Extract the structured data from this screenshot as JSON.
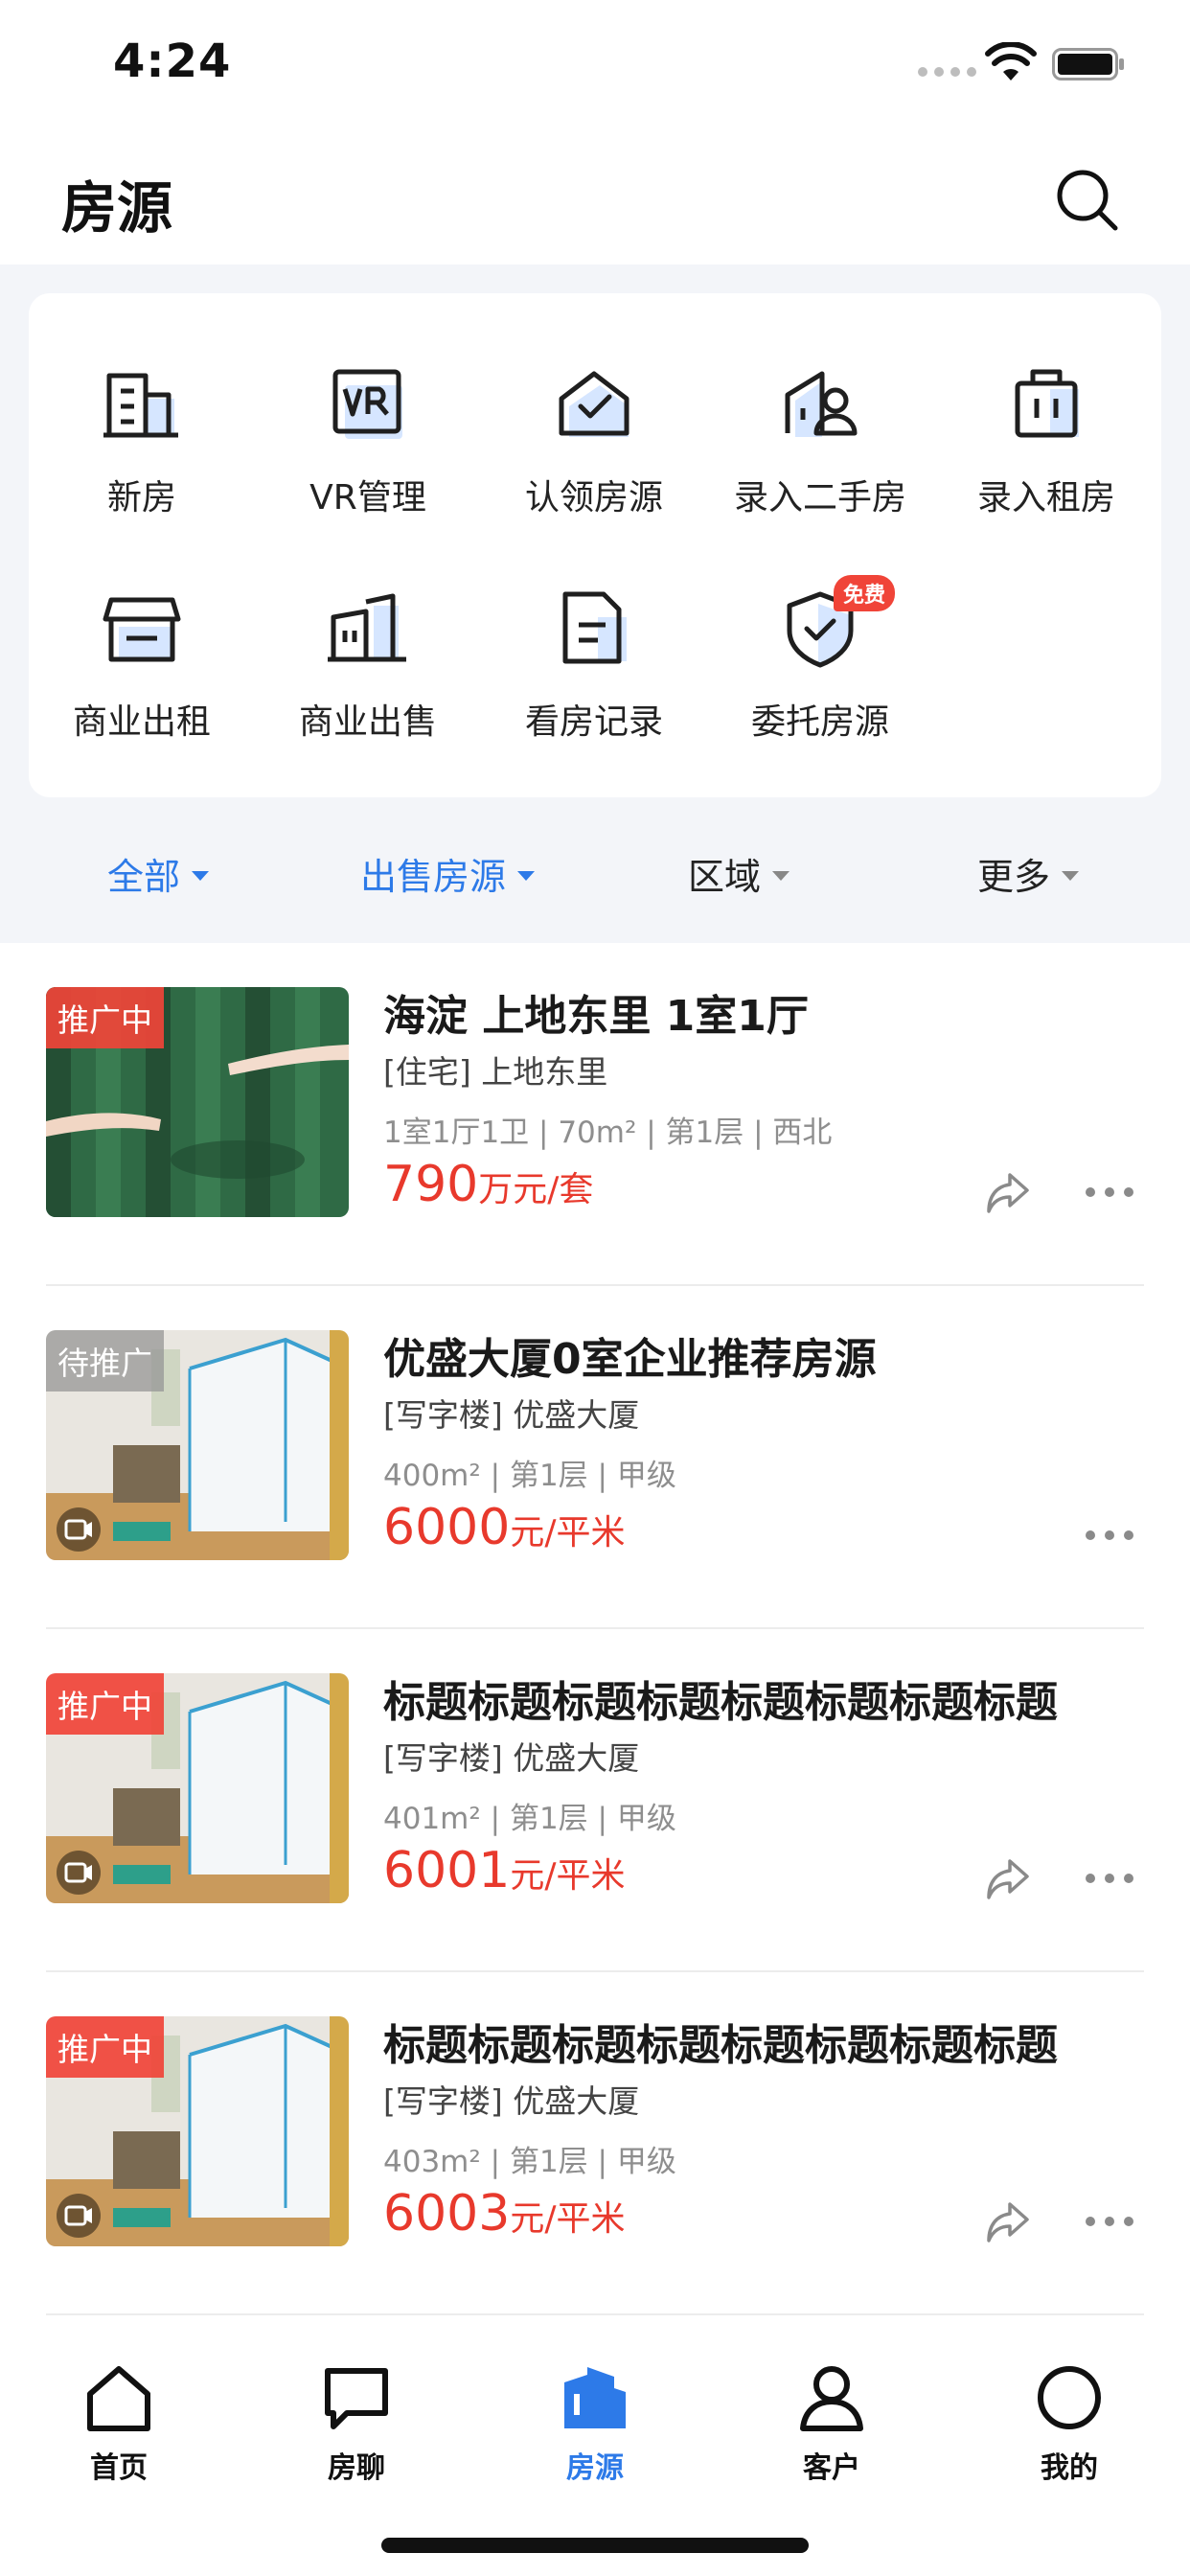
{
  "status_bar": {
    "time": "4:24"
  },
  "header": {
    "title": "房源",
    "search_icon": "search-icon"
  },
  "quick_actions": [
    {
      "label": "新房",
      "icon": "building-icon"
    },
    {
      "label": "VR管理",
      "icon": "vr-icon"
    },
    {
      "label": "认领房源",
      "icon": "house-check-icon"
    },
    {
      "label": "录入二手房",
      "icon": "house-person-icon"
    },
    {
      "label": "录入租房",
      "icon": "suitcase-icon"
    },
    {
      "label": "商业出租",
      "icon": "storefront-icon"
    },
    {
      "label": "商业出售",
      "icon": "office-building-icon"
    },
    {
      "label": "看房记录",
      "icon": "document-icon"
    },
    {
      "label": "委托房源",
      "icon": "shield-check-icon",
      "badge": "免费"
    }
  ],
  "filters": [
    {
      "label": "全部",
      "active": true
    },
    {
      "label": "出售房源",
      "active": true
    },
    {
      "label": "区域",
      "active": false
    },
    {
      "label": "更多",
      "active": false
    }
  ],
  "listings": [
    {
      "tag": "推广中",
      "title": "海淀 上地东里 1室1厅",
      "subtitle": "[住宅] 上地东里",
      "specs": "1室1厅1卫 | 70m² | 第1层 | 西北",
      "price": "790",
      "unit": "万元/套",
      "has_share": true,
      "has_video": false
    },
    {
      "tag": "待推广",
      "title": "优盛大厦0室企业推荐房源",
      "subtitle": "[写字楼] 优盛大厦",
      "specs": "400m² | 第1层 | 甲级",
      "price": "6000",
      "unit": "元/平米",
      "has_share": false,
      "has_video": true
    },
    {
      "tag": "推广中",
      "title": "标题标题标题标题标题标题标题标题",
      "subtitle": "[写字楼] 优盛大厦",
      "specs": "401m² | 第1层 | 甲级",
      "price": "6001",
      "unit": "元/平米",
      "has_share": true,
      "has_video": true
    },
    {
      "tag": "推广中",
      "title": "标题标题标题标题标题标题标题标题",
      "subtitle": "[写字楼] 优盛大厦",
      "specs": "403m² | 第1层 | 甲级",
      "price": "6003",
      "unit": "元/平米",
      "has_share": true,
      "has_video": true
    }
  ],
  "tabbar": [
    {
      "label": "首页",
      "icon": "home-icon",
      "active": false
    },
    {
      "label": "房聊",
      "icon": "chat-icon",
      "active": false
    },
    {
      "label": "房源",
      "icon": "building-icon",
      "active": true
    },
    {
      "label": "客户",
      "icon": "person-icon",
      "active": false
    },
    {
      "label": "我的",
      "icon": "profile-circle-icon",
      "active": false
    }
  ],
  "colors": {
    "accent": "#2d7ae8",
    "price": "#e8392c",
    "promo": "#f04438",
    "panel_bg": "#f3f5f9"
  }
}
